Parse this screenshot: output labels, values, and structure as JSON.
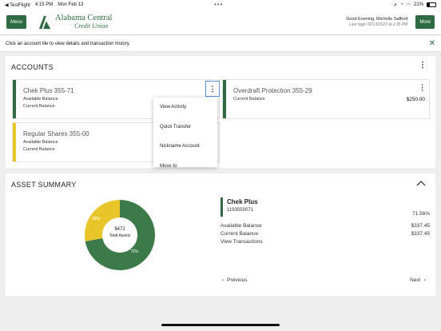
{
  "status_bar": {
    "back_app": "◀ TestFlight",
    "time": "4:15 PM",
    "date": "Mon Feb 13",
    "dots": "•••",
    "battery_pct": "21%"
  },
  "header": {
    "menu_label": "Menu",
    "more_label": "More",
    "logo_line1": "Alabama Central",
    "logo_line2": "Credit Union",
    "greeting": "Good Evening, Michelle Safford",
    "last_login": "Last login 02/13/2023 at 2:35 PM"
  },
  "info_bar": {
    "text": "Click an account tile to view details and transaction history."
  },
  "accounts": {
    "title": "ACCOUNTS",
    "tiles": [
      {
        "name": "Chek Plus 355-71",
        "line1": "Available Balance",
        "line2": "Current Balance",
        "color": "#2e6b42"
      },
      {
        "name": "Overdraft Protection 355-29",
        "line1": "Current Balance",
        "value": "$250.00",
        "color": "#2e6b42"
      },
      {
        "name": "Regular Shares 355-00",
        "line1": "Available Balance",
        "line2": "Current Balance",
        "color": "#e8c62a"
      }
    ],
    "menu": {
      "items": [
        "View Activity",
        "Quick Transfer",
        "Nickname Account",
        "Move to"
      ]
    }
  },
  "asset_summary": {
    "title": "ASSET SUMMARY",
    "total": "$472",
    "total_label": "Total Assets",
    "slices": [
      {
        "label": "72%",
        "value": 72,
        "color": "#3d7a4a"
      },
      {
        "label": "28%",
        "value": 28,
        "color": "#e8c62a"
      }
    ],
    "detail": {
      "name": "Chek Plus",
      "number": "1193550071",
      "percent": "71.56%",
      "rows": [
        {
          "label": "Available Balance",
          "value": "$337.45"
        },
        {
          "label": "Current Balance",
          "value": "$337.45"
        }
      ],
      "view_transactions": "View Transactions"
    },
    "previous": "Previous",
    "next": "Next"
  },
  "colors": {
    "brand": "#2e6b42",
    "yellow": "#e8c62a"
  }
}
